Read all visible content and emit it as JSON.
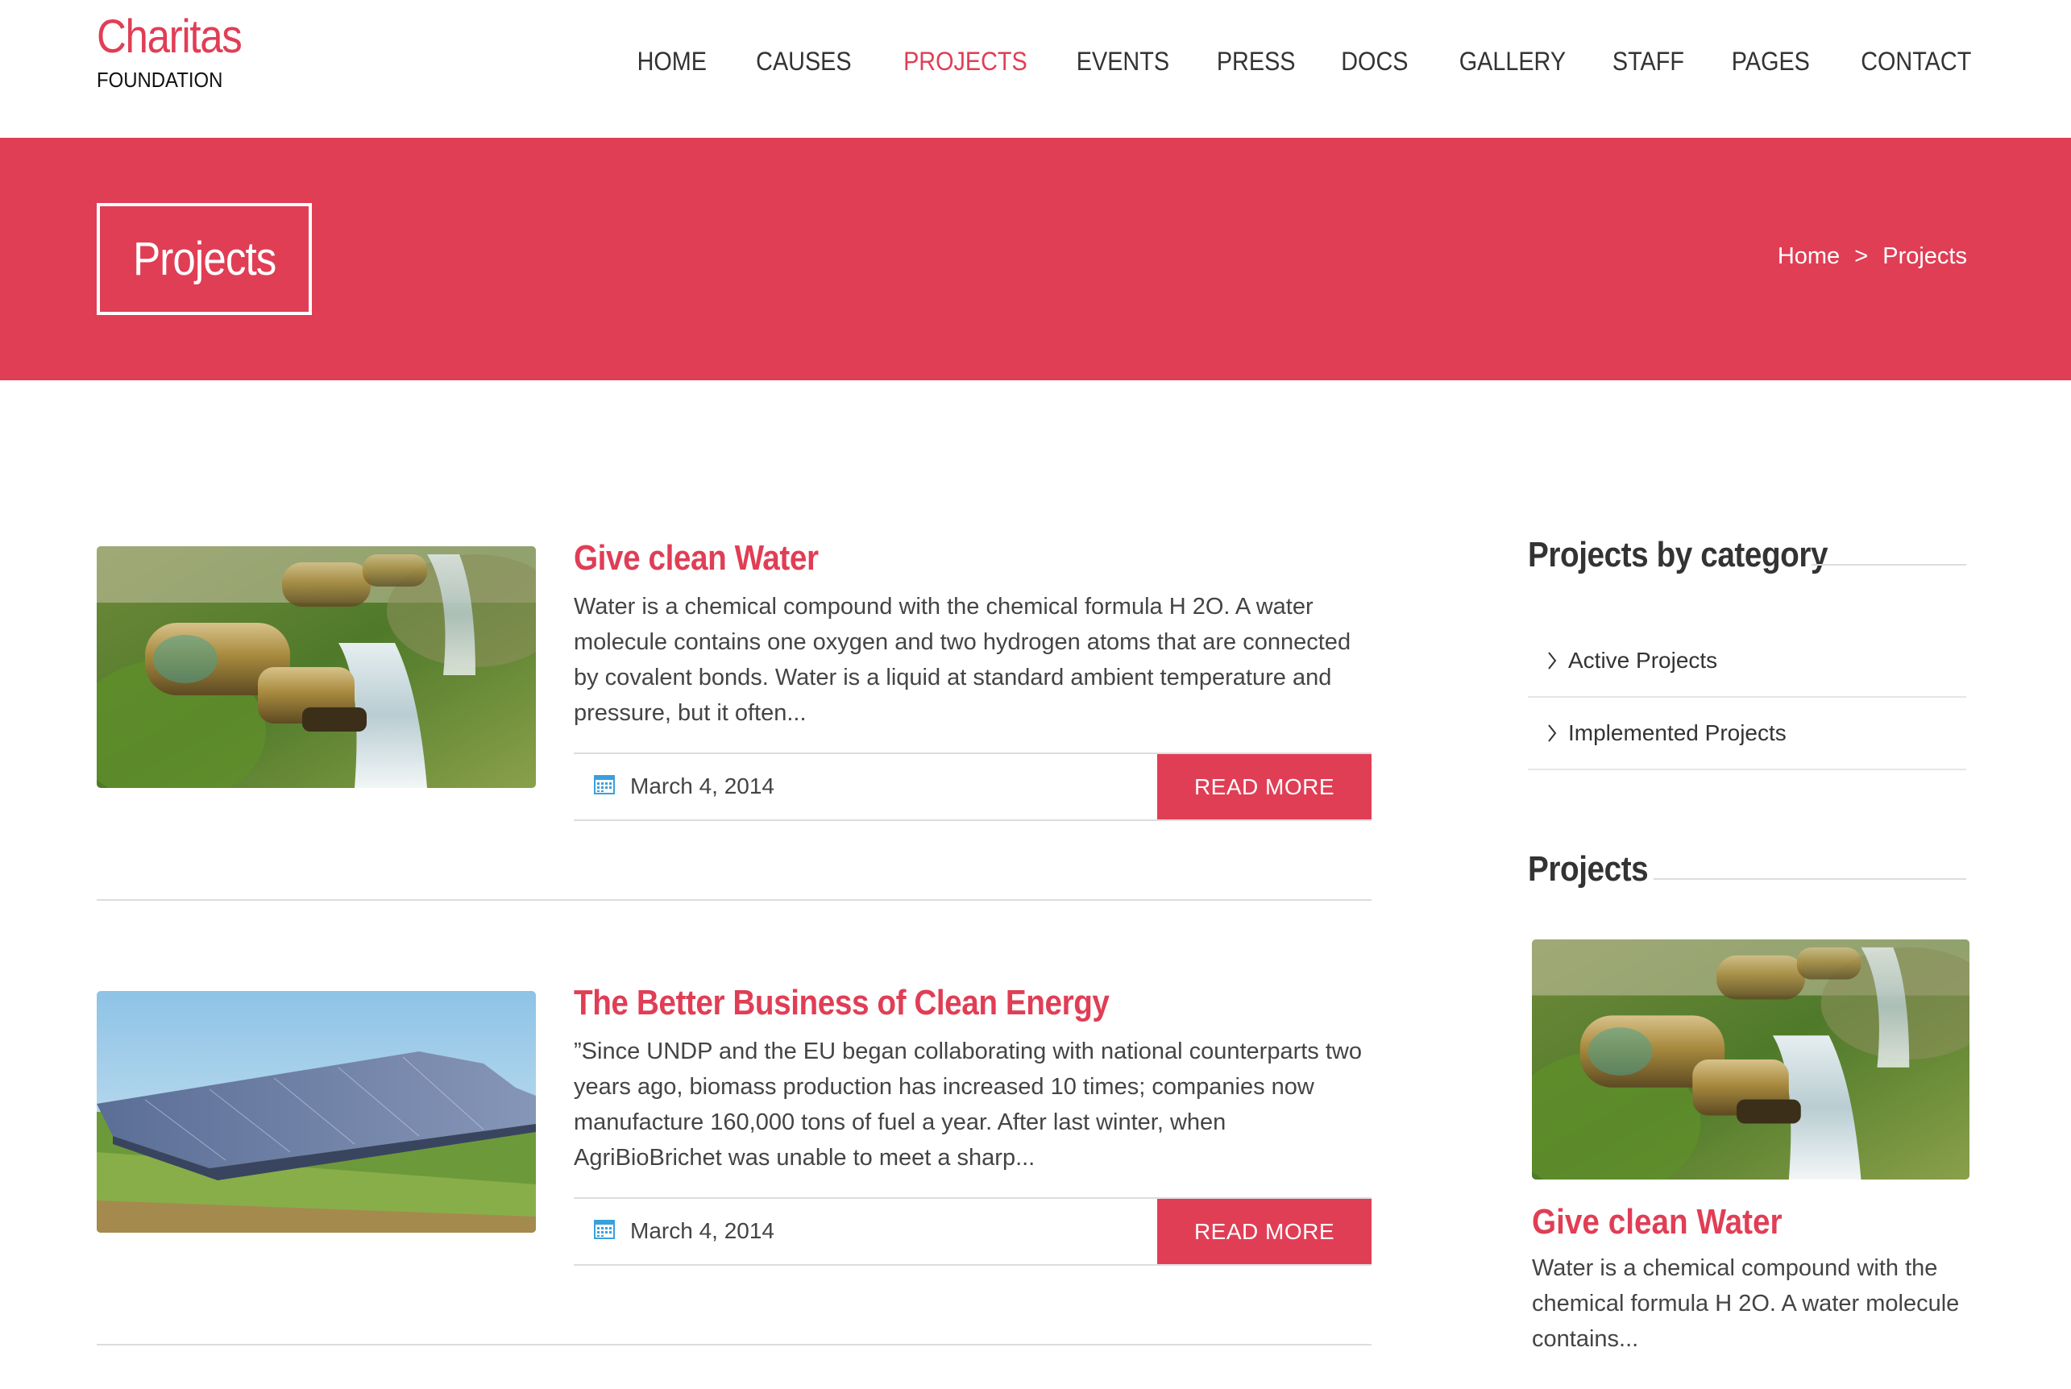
{
  "brand": {
    "name": "Charitas",
    "tagline": "FOUNDATION",
    "accent_color": "#e03e55"
  },
  "nav": {
    "items": [
      {
        "label": "HOME"
      },
      {
        "label": "CAUSES"
      },
      {
        "label": "PROJECTS",
        "active": true
      },
      {
        "label": "EVENTS"
      },
      {
        "label": "PRESS"
      },
      {
        "label": "DOCS"
      },
      {
        "label": "GALLERY"
      },
      {
        "label": "STAFF"
      },
      {
        "label": "PAGES"
      },
      {
        "label": "CONTACT"
      }
    ]
  },
  "banner": {
    "title": "Projects",
    "breadcrumb": {
      "home": "Home",
      "separator": ">",
      "current": "Projects"
    }
  },
  "projects": [
    {
      "title": "Give clean Water",
      "excerpt": "Water is a chemical compound with the chemical formula H 2O. A water molecule contains one oxygen and two hydrogen atoms that are connected by covalent bonds. Water is a liquid at standard ambient temperature and pressure, but it often...",
      "date": "March 4, 2014",
      "read_more": "READ MORE",
      "image": "water-tap-image"
    },
    {
      "title": "The Better Business of Clean Energy",
      "excerpt": "”Since UNDP and the EU began collaborating with national counterparts two years ago, biomass production has increased 10 times; companies now manufacture 160,000 tons of fuel a year. After last winter, when AgriBioBrichet was unable to meet a sharp...",
      "date": "March 4, 2014",
      "read_more": "READ MORE",
      "image": "solar-panels-image"
    }
  ],
  "sidebar": {
    "categories_title": "Projects by category",
    "categories": [
      {
        "label": "Active Projects",
        "icon": "chevron-right-icon"
      },
      {
        "label": "Implemented Projects",
        "icon": "chevron-right-icon"
      }
    ],
    "projects_title": "Projects",
    "featured": {
      "title": "Give clean Water",
      "excerpt": "Water is a chemical compound with the chemical formula H 2O. A water molecule contains...",
      "image": "water-tap-image"
    }
  }
}
